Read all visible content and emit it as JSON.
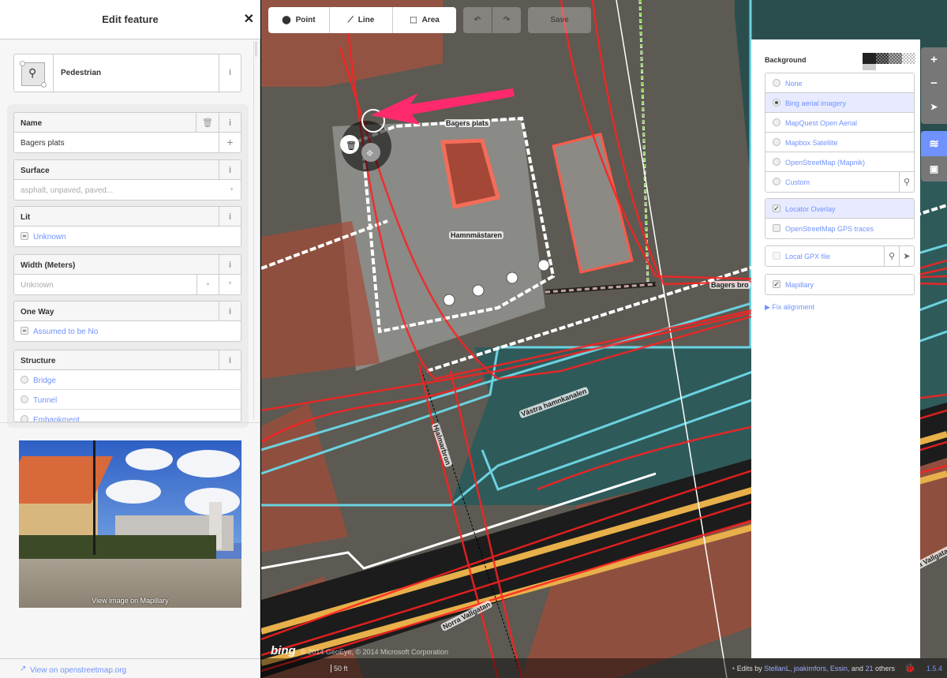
{
  "sidebar": {
    "title": "Edit feature",
    "close_icon": "✕",
    "preset": {
      "name": "Pedestrian",
      "icon": "map-pin-icon",
      "info": "i"
    },
    "fields": {
      "name": {
        "label": "Name",
        "value": "Bagers plats",
        "info": "i",
        "add": "+"
      },
      "surface": {
        "label": "Surface",
        "placeholder": "asphalt, unpaved, paved...",
        "info": "i"
      },
      "lit": {
        "label": "Lit",
        "value": "Unknown",
        "info": "i"
      },
      "width": {
        "label": "Width (Meters)",
        "placeholder": "Unknown",
        "info": "i"
      },
      "oneway": {
        "label": "One Way",
        "value": "Assumed to be No",
        "info": "i"
      },
      "structure": {
        "label": "Structure",
        "info": "i",
        "options": [
          "Bridge",
          "Tunnel",
          "Embankment"
        ]
      }
    },
    "mapillary": {
      "caption": "View image on Mapillary"
    },
    "footer": {
      "link": "View on openstreetmap.org",
      "icon": "external-link-icon"
    }
  },
  "toolbar": {
    "point": "Point",
    "line": "Line",
    "area": "Area",
    "undo_icon": "↶",
    "redo_icon": "↷",
    "save": "Save"
  },
  "background": {
    "title": "Background",
    "opacity_levels": [
      1.0,
      0.75,
      0.5,
      0.25
    ],
    "opacity_selected": 1.0,
    "layers": [
      {
        "label": "None",
        "selected": false
      },
      {
        "label": "Bing aerial imagery",
        "selected": true
      },
      {
        "label": "MapQuest Open Aerial",
        "selected": false
      },
      {
        "label": "Mapbox Satellite",
        "selected": false
      },
      {
        "label": "OpenStreetMap (Mapnik)",
        "selected": false
      },
      {
        "label": "Custom",
        "selected": false
      }
    ],
    "overlays": [
      {
        "label": "Locator Overlay",
        "checked": true
      },
      {
        "label": "OpenStreetMap GPS traces",
        "checked": false
      }
    ],
    "gpx": {
      "label": "Local GPX file",
      "checked": false
    },
    "mapillary": {
      "label": "Mapillary",
      "checked": true
    },
    "fix_alignment": "Fix alignment"
  },
  "map_controls": {
    "zoom_in": "+",
    "zoom_out": "−",
    "locate": "➤",
    "background": "layers-icon",
    "map_data": "map-data-icon"
  },
  "map": {
    "labels": {
      "bagers_plats": "Bagers plats",
      "hamnmastaren": "Hamnmästaren",
      "bagers_bro": "Bagers bro",
      "vastra_hamnkanalen": "Västra hamnkanalen",
      "hjalmarbron": "Hjalmarbron",
      "norra_vallgatan": "Norra Vallgatan"
    },
    "attribution": "© 2014 GeoEye, © 2014 Microsoft Corporation",
    "bing_logo": "bing",
    "scale": "50 ft",
    "edits_prefix": "Edits by",
    "editors": [
      "StellanL,",
      "joakimfors,",
      "Essin,"
    ],
    "edits_and": "and",
    "others_count": "21",
    "others_label": "others",
    "version": "1.5.4"
  },
  "colors": {
    "accent": "#7092ff",
    "highlight_arrow": "#ff2a6d",
    "water": "#2f5a5a",
    "gps_trace": "#ff2020",
    "building": "#b0503c"
  }
}
